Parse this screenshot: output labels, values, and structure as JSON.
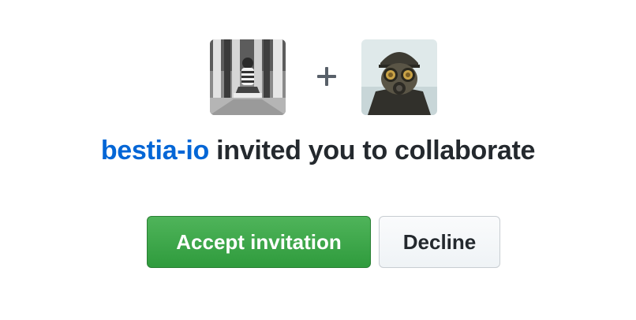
{
  "invite": {
    "inviter": "bestia-io",
    "message": "invited you to collaborate",
    "plus_symbol": "+"
  },
  "avatars": {
    "inviter_icon": "user-avatar-photo",
    "invitee_icon": "gas-mask-avatar-photo"
  },
  "actions": {
    "accept_label": "Accept invitation",
    "decline_label": "Decline"
  },
  "colors": {
    "link": "#0366d6",
    "accept_bg": "#34a043",
    "text": "#24292e"
  }
}
